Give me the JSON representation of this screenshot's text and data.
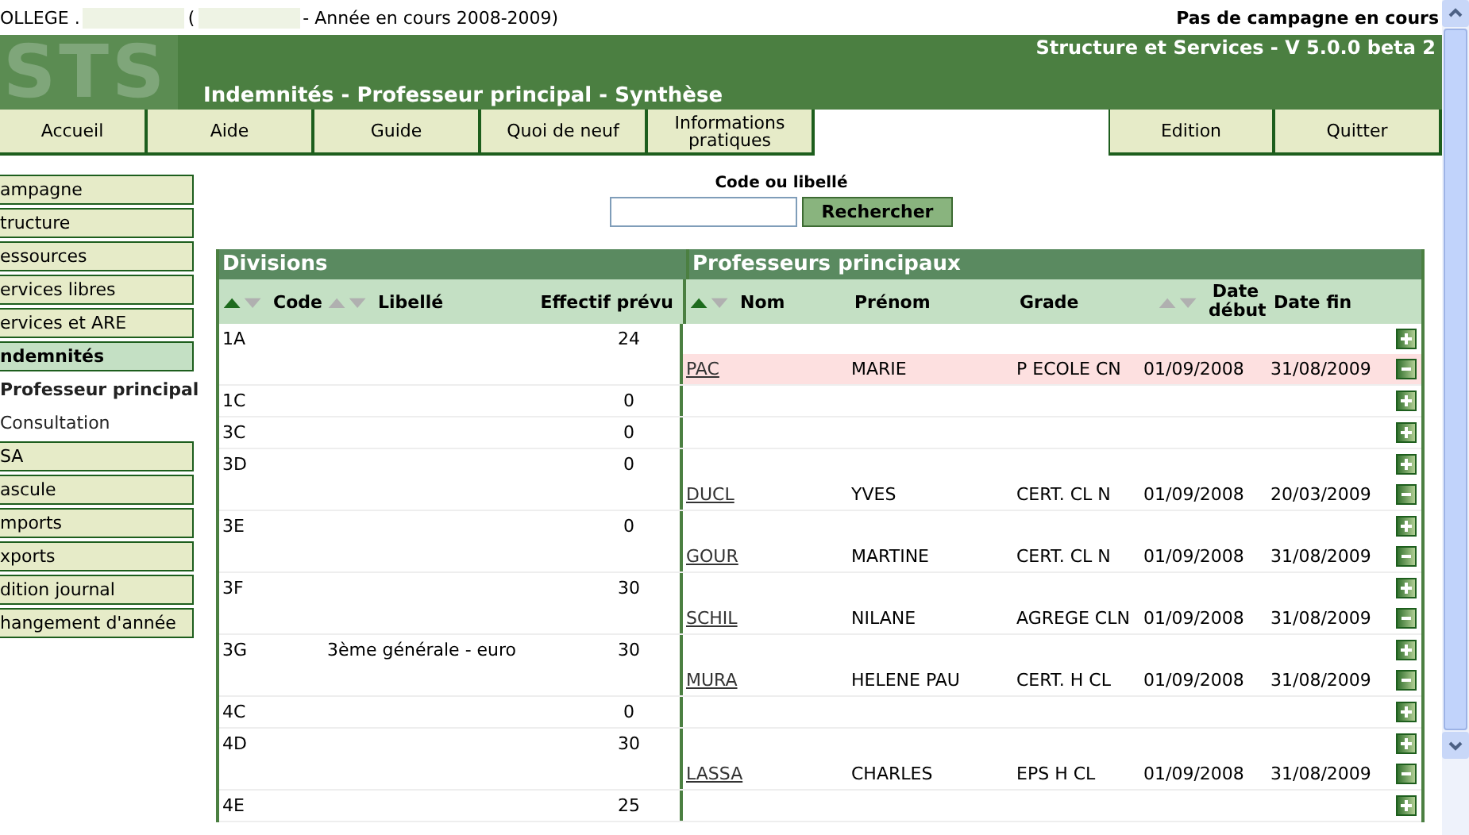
{
  "top_bar": {
    "segments": [
      {
        "kind": "text",
        "text": "OLLEGE ."
      },
      {
        "kind": "redacted"
      },
      {
        "kind": "text",
        "text": "("
      },
      {
        "kind": "redacted"
      },
      {
        "kind": "text",
        "text": "- Année en cours 2008-2009)"
      }
    ],
    "campaign_status": "Pas de campagne en cours"
  },
  "header": {
    "logo": "STS",
    "version": "Structure et Services - V 5.0.0 beta 2",
    "page_title": "Indemnités - Professeur principal - Synthèse"
  },
  "tabs_left": [
    {
      "label": "Accueil"
    },
    {
      "label": "Aide"
    },
    {
      "label": "Guide"
    },
    {
      "label": "Quoi de neuf"
    },
    {
      "label": "Informations pratiques"
    }
  ],
  "tabs_right": [
    {
      "label": "Edition"
    },
    {
      "label": "Quitter"
    }
  ],
  "sidebar": {
    "items": [
      {
        "label": "ampagne",
        "kind": "button",
        "selected": false
      },
      {
        "label": "tructure",
        "kind": "button",
        "selected": false
      },
      {
        "label": "essources",
        "kind": "button",
        "selected": false
      },
      {
        "label": "ervices libres",
        "kind": "button",
        "selected": false
      },
      {
        "label": "ervices et ARE",
        "kind": "button",
        "selected": false
      },
      {
        "label": "ndemnités",
        "kind": "button",
        "selected": true
      },
      {
        "label": "Professeur principal",
        "kind": "sub",
        "selected": true
      },
      {
        "label": "Consultation",
        "kind": "sub",
        "selected": false
      },
      {
        "label": "SA",
        "kind": "button",
        "selected": false
      },
      {
        "label": "ascule",
        "kind": "button",
        "selected": false
      },
      {
        "label": "mports",
        "kind": "button",
        "selected": false
      },
      {
        "label": "xports",
        "kind": "button",
        "selected": false
      },
      {
        "label": "dition journal",
        "kind": "button",
        "selected": false
      },
      {
        "label": "hangement d'année",
        "kind": "button",
        "selected": false
      }
    ]
  },
  "search": {
    "label": "Code ou libellé",
    "button": "Rechercher"
  },
  "divisions": {
    "title": "Divisions",
    "columns": [
      {
        "label": "Code",
        "sorted": true
      },
      {
        "label": "Libellé",
        "sorted": false
      },
      {
        "label": "Effectif prévu"
      }
    ]
  },
  "professeurs": {
    "title": "Professeurs principaux",
    "columns": [
      {
        "label": "Nom",
        "sorted": true
      },
      {
        "label": "Prénom"
      },
      {
        "label": "Grade"
      },
      {
        "label": "Date début",
        "sorted": false
      },
      {
        "label": "Date fin"
      }
    ]
  },
  "rows": [
    {
      "code": "1A",
      "libelle": "",
      "effectif": "24",
      "entries": [
        {
          "kind": "add"
        },
        {
          "kind": "teacher",
          "nom": "PAC",
          "prenom": "MARIE",
          "grade": "P ECOLE CN",
          "date_debut": "01/09/2008",
          "date_fin": "31/08/2009",
          "highlighted": true
        }
      ]
    },
    {
      "code": "1C",
      "libelle": "",
      "effectif": "0",
      "entries": [
        {
          "kind": "add"
        }
      ]
    },
    {
      "code": "3C",
      "libelle": "",
      "effectif": "0",
      "entries": [
        {
          "kind": "add"
        }
      ]
    },
    {
      "code": "3D",
      "libelle": "",
      "effectif": "0",
      "entries": [
        {
          "kind": "add"
        },
        {
          "kind": "teacher",
          "nom": "DUCL",
          "prenom": "YVES",
          "grade": "CERT. CL N",
          "date_debut": "01/09/2008",
          "date_fin": "20/03/2009",
          "highlighted": false
        }
      ]
    },
    {
      "code": "3E",
      "libelle": "",
      "effectif": "0",
      "entries": [
        {
          "kind": "add"
        },
        {
          "kind": "teacher",
          "nom": "GOUR",
          "prenom": "MARTINE",
          "grade": "CERT. CL N",
          "date_debut": "01/09/2008",
          "date_fin": "31/08/2009",
          "highlighted": false
        }
      ]
    },
    {
      "code": "3F",
      "libelle": "",
      "effectif": "30",
      "entries": [
        {
          "kind": "add"
        },
        {
          "kind": "teacher",
          "nom": "SCHIL",
          "prenom": "NILANE",
          "grade": "AGREGE CLN",
          "date_debut": "01/09/2008",
          "date_fin": "31/08/2009",
          "highlighted": false
        }
      ]
    },
    {
      "code": "3G",
      "libelle": "3ème générale - euro",
      "effectif": "30",
      "entries": [
        {
          "kind": "add"
        },
        {
          "kind": "teacher",
          "nom": "MURA",
          "prenom": "HELENE PAU",
          "grade": "CERT. H CL",
          "date_debut": "01/09/2008",
          "date_fin": "31/08/2009",
          "highlighted": false
        }
      ]
    },
    {
      "code": "4C",
      "libelle": "",
      "effectif": "0",
      "entries": [
        {
          "kind": "add"
        }
      ]
    },
    {
      "code": "4D",
      "libelle": "",
      "effectif": "30",
      "entries": [
        {
          "kind": "add"
        },
        {
          "kind": "teacher",
          "nom": "LASSA",
          "prenom": "CHARLES",
          "grade": "EPS H CL",
          "date_debut": "01/09/2008",
          "date_fin": "31/08/2009",
          "highlighted": false
        }
      ]
    },
    {
      "code": "4E",
      "libelle": "",
      "effectif": "25",
      "entries": [
        {
          "kind": "add"
        }
      ]
    }
  ]
}
